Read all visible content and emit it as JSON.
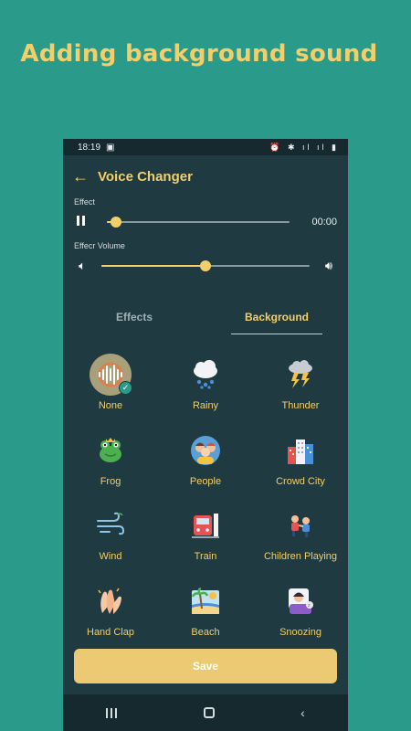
{
  "headline": "Adding background sound",
  "status_bar": {
    "time": "18:19",
    "right_icons": "⏰ ✱ ıl ıl ▮"
  },
  "app_bar": {
    "title": "Voice Changer",
    "back_icon": "arrow-left-icon"
  },
  "effect": {
    "label": "Effect",
    "time": "00:00",
    "progress": 0.05
  },
  "volume": {
    "label": "Effecr Volume",
    "level": 0.5
  },
  "tabs": [
    {
      "label": "Effects",
      "active": false
    },
    {
      "label": "Background",
      "active": true
    }
  ],
  "sounds": [
    {
      "label": "None",
      "icon": "sound-wave-icon",
      "selected": true
    },
    {
      "label": "Rainy",
      "icon": "rain-cloud-icon"
    },
    {
      "label": "Thunder",
      "icon": "thunder-cloud-icon"
    },
    {
      "label": "Frog",
      "icon": "frog-icon"
    },
    {
      "label": "People",
      "icon": "people-icon"
    },
    {
      "label": "Crowd City",
      "icon": "city-buildings-icon"
    },
    {
      "label": "Wind",
      "icon": "wind-icon"
    },
    {
      "label": "Train",
      "icon": "train-icon"
    },
    {
      "label": "Children Playing",
      "icon": "children-playing-icon"
    },
    {
      "label": "Hand Clap",
      "icon": "hand-clap-icon"
    },
    {
      "label": "Beach",
      "icon": "beach-icon"
    },
    {
      "label": "Snoozing",
      "icon": "snoozing-icon"
    }
  ],
  "save_label": "Save",
  "colors": {
    "background": "#2a9a8a",
    "panel": "#1f3a41",
    "accent": "#f2cf6a",
    "button": "#ecca73"
  }
}
